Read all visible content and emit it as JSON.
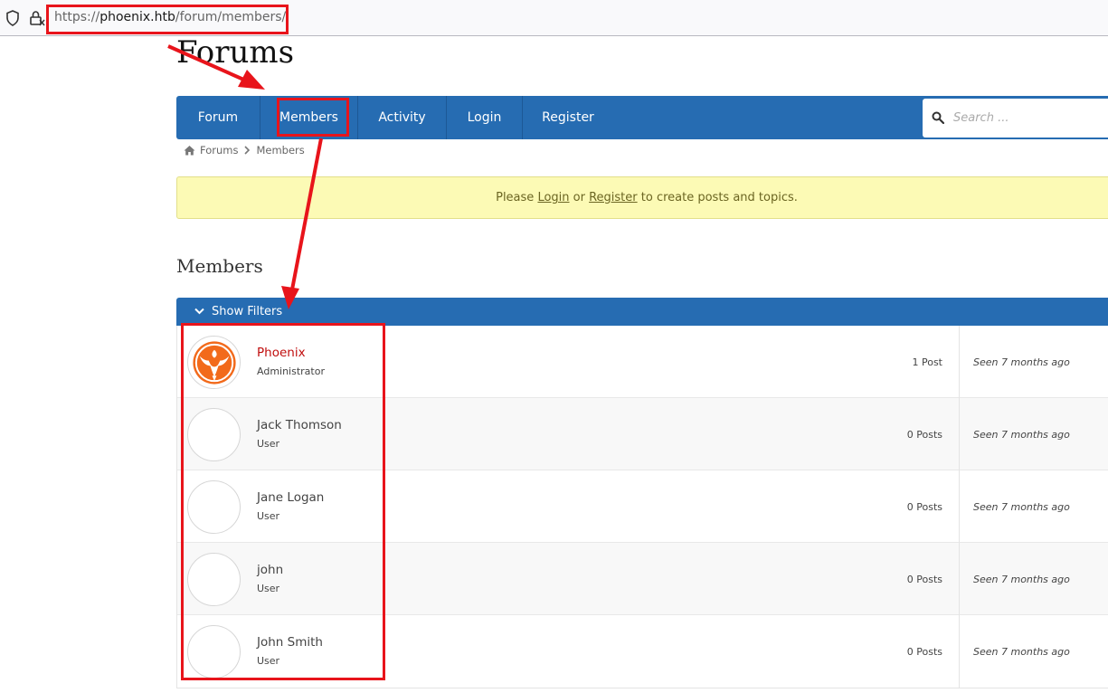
{
  "browser": {
    "url_scheme": "https://",
    "url_host": "phoenix.htb",
    "url_path": "/forum/members/"
  },
  "site": {
    "title": "Forums"
  },
  "nav": {
    "items": [
      {
        "label": "Forum"
      },
      {
        "label": "Members"
      },
      {
        "label": "Activity"
      },
      {
        "label": "Login"
      },
      {
        "label": "Register"
      }
    ],
    "search_placeholder": "Search ..."
  },
  "breadcrumb": {
    "items": [
      "Forums",
      "Members"
    ]
  },
  "alert": {
    "prefix": "Please ",
    "login_link": "Login",
    "middle": " or ",
    "register_link": "Register",
    "suffix": " to create posts and topics."
  },
  "members_page": {
    "title": "Members",
    "filter_label": "Show Filters",
    "members": [
      {
        "name": "Phoenix",
        "role": "Administrator",
        "posts": "1 Post",
        "seen": "Seen 7 months ago"
      },
      {
        "name": "Jack Thomson",
        "role": "User",
        "posts": "0 Posts",
        "seen": "Seen 7 months ago"
      },
      {
        "name": "Jane Logan",
        "role": "User",
        "posts": "0 Posts",
        "seen": "Seen 7 months ago"
      },
      {
        "name": "john",
        "role": "User",
        "posts": "0 Posts",
        "seen": "Seen 7 months ago"
      },
      {
        "name": "John Smith",
        "role": "User",
        "posts": "0 Posts",
        "seen": "Seen 7 months ago"
      }
    ]
  },
  "colors": {
    "nav_blue": "#266cb2",
    "admin_red": "#c00d0d",
    "alert_yellow": "#fcfab5",
    "annotation_red": "#e8141b",
    "phoenix_orange": "#f26a1b"
  }
}
